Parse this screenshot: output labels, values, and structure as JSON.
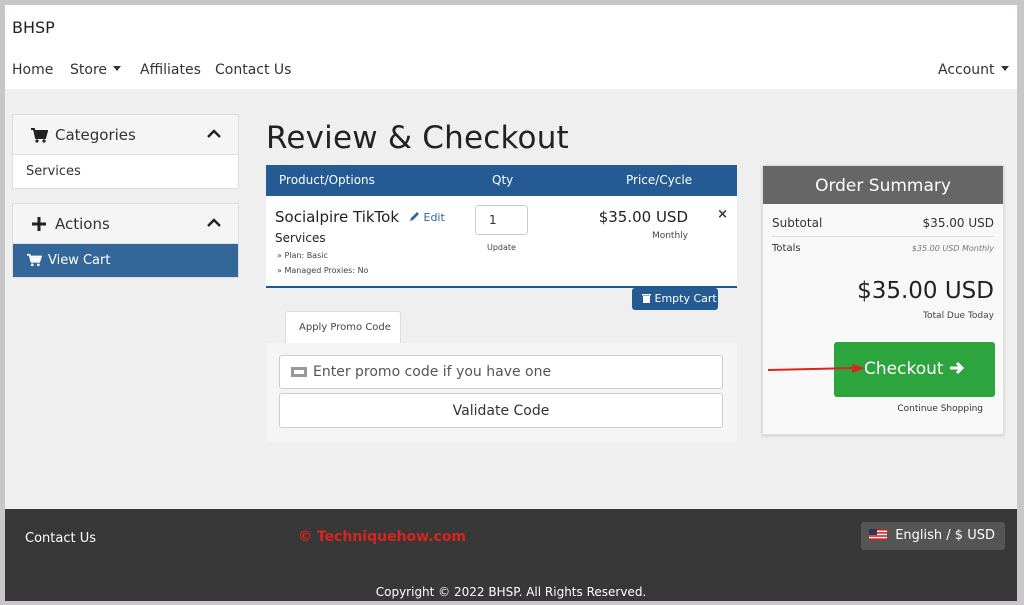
{
  "app": {
    "brand": "BHSP"
  },
  "nav": {
    "items": [
      "Home",
      "Store",
      "Affiliates",
      "Contact Us"
    ],
    "account": "Account"
  },
  "sidebar": {
    "categories": {
      "title": "Categories",
      "items": [
        "Services"
      ]
    },
    "actions": {
      "title": "Actions",
      "items": [
        "View Cart"
      ]
    }
  },
  "page": {
    "title": "Review & Checkout"
  },
  "cart": {
    "headers": {
      "product": "Product/Options",
      "qty": "Qty",
      "price": "Price/Cycle"
    },
    "item": {
      "name": "Socialpire TikTok",
      "edit": "Edit",
      "group": "Services",
      "options": [
        "» Plan: Basic",
        "» Managed Proxies: No"
      ],
      "qty": "1",
      "update": "Update",
      "price": "$35.00 USD",
      "cycle": "Monthly",
      "remove": "×"
    },
    "empty_cart": "Empty Cart"
  },
  "promo": {
    "tab": "Apply Promo Code",
    "placeholder": "Enter promo code if you have one",
    "validate": "Validate Code"
  },
  "summary": {
    "title": "Order Summary",
    "subtotal_label": "Subtotal",
    "subtotal_value": "$35.00 USD",
    "totals_label": "Totals",
    "totals_value": "$35.00 USD Monthly",
    "total": "$35.00 USD",
    "total_due": "Total Due Today",
    "checkout": "Checkout",
    "continue": "Continue Shopping"
  },
  "footer": {
    "contact": "Contact Us",
    "watermark": "© Techniquehow.com",
    "language": "English / $ USD",
    "copyright": "Copyright © 2022 BHSP. All Rights Reserved."
  },
  "colors": {
    "primary": "#235b92",
    "sidebar_active": "#336699",
    "checkout": "#2da53e",
    "summary_header": "#666666",
    "footer": "#383838",
    "annotation_arrow": "#d8251e"
  }
}
